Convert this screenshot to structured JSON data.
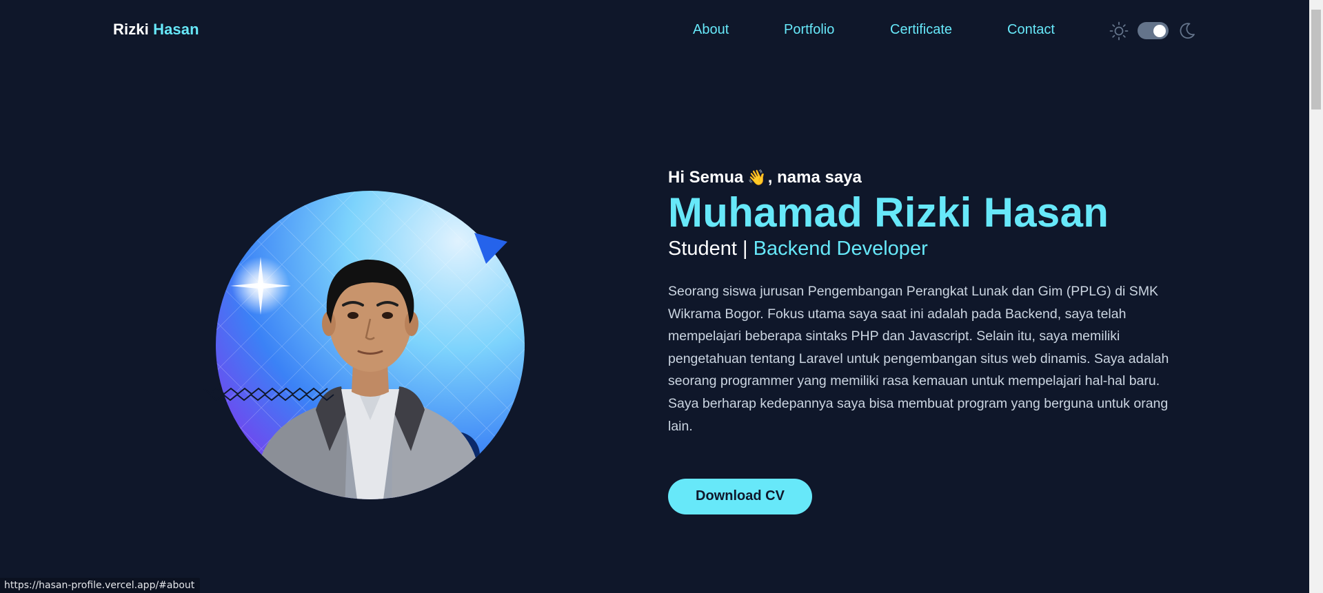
{
  "navbar": {
    "brand_first": "Rizki",
    "brand_second": "Hasan",
    "links": [
      {
        "label": "About"
      },
      {
        "label": "Portfolio"
      },
      {
        "label": "Certificate"
      },
      {
        "label": "Contact"
      }
    ],
    "theme_toggle": {
      "state": "dark",
      "left_icon": "sun-icon",
      "right_icon": "moon-icon"
    }
  },
  "hero": {
    "greeting_start": "Hi Semua",
    "greeting_emoji": "👋",
    "greeting_end": ", nama saya",
    "name": "Muhamad Rizki Hasan",
    "role_prefix": "Student | ",
    "role_accent": "Backend Developer",
    "bio": "Seorang siswa jurusan Pengembangan Perangkat Lunak dan Gim (PPLG) di SMK Wikrama Bogor. Fokus utama saya saat ini adalah pada Backend, saya telah mempelajari beberapa sintaks PHP dan Javascript. Selain itu, saya memiliki pengetahuan tentang Laravel untuk pengembangan situs web dinamis. Saya adalah seorang programmer yang memiliki rasa kemauan untuk mempelajari hal-hal baru. Saya berharap kedepannya saya bisa membuat program yang berguna untuk orang lain.",
    "cta_label": "Download CV"
  },
  "status_bar": {
    "url": "https://hasan-profile.vercel.app/#about"
  },
  "colors": {
    "background": "#0f172a",
    "accent": "#67e8f9",
    "text": "#ffffff",
    "muted_text": "#cbd5e1"
  }
}
